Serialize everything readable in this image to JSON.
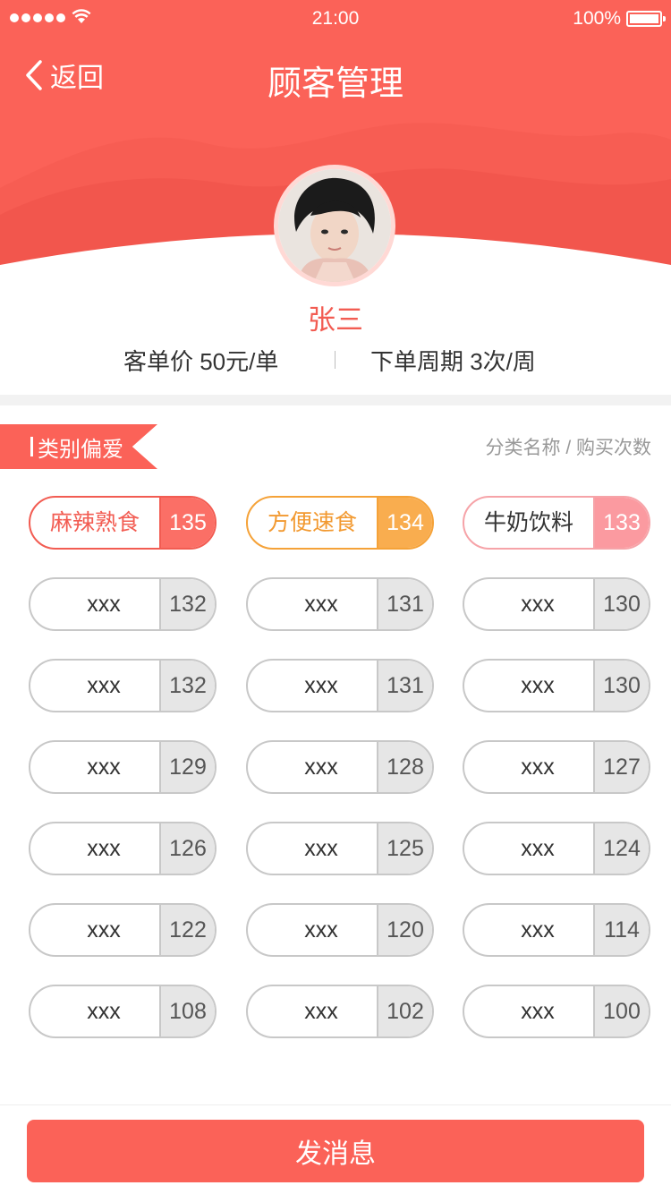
{
  "status_bar": {
    "time": "21:00",
    "battery": "100%"
  },
  "nav": {
    "back_label": "返回",
    "title": "顾客管理"
  },
  "customer": {
    "name": "张三",
    "avg_order_label": "客单价 50元/单",
    "order_cycle_label": "下单周期  3次/周"
  },
  "section": {
    "tag": "类别偏爱",
    "hint": "分类名称 / 购买次数"
  },
  "categories": [
    {
      "name": "麻辣熟食",
      "count": "135"
    },
    {
      "name": "方便速食",
      "count": "134"
    },
    {
      "name": "牛奶饮料",
      "count": "133"
    },
    {
      "name": "xxx",
      "count": "132"
    },
    {
      "name": "xxx",
      "count": "131"
    },
    {
      "name": "xxx",
      "count": "130"
    },
    {
      "name": "xxx",
      "count": "132"
    },
    {
      "name": "xxx",
      "count": "131"
    },
    {
      "name": "xxx",
      "count": "130"
    },
    {
      "name": "xxx",
      "count": "129"
    },
    {
      "name": "xxx",
      "count": "128"
    },
    {
      "name": "xxx",
      "count": "127"
    },
    {
      "name": "xxx",
      "count": "126"
    },
    {
      "name": "xxx",
      "count": "125"
    },
    {
      "name": "xxx",
      "count": "124"
    },
    {
      "name": "xxx",
      "count": "122"
    },
    {
      "name": "xxx",
      "count": "120"
    },
    {
      "name": "xxx",
      "count": "114"
    },
    {
      "name": "xxx",
      "count": "108"
    },
    {
      "name": "xxx",
      "count": "102"
    },
    {
      "name": "xxx",
      "count": "100"
    }
  ],
  "footer": {
    "send_label": "发消息"
  },
  "colors": {
    "brand_red": "#fb6258",
    "accent_orange": "#f5a238",
    "accent_pink": "#fb9aa0",
    "neutral_gray": "#e6e6e6"
  }
}
